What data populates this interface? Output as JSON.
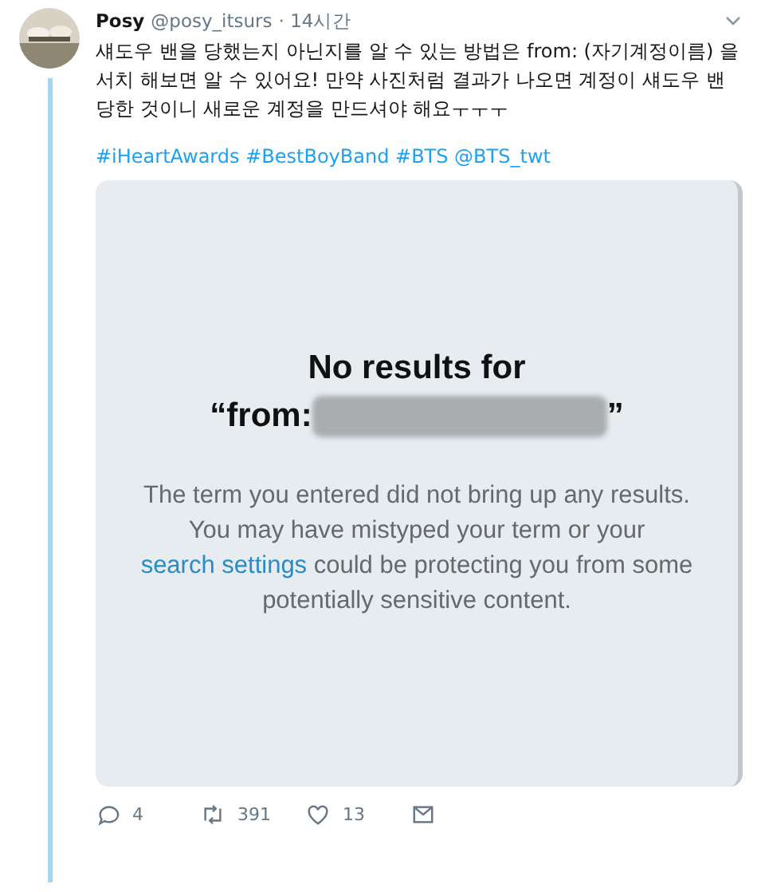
{
  "tweet": {
    "name": "Posy",
    "handle": "@posy_itsurs",
    "time": "· 14시간",
    "text": "섀도우 밴을 당했는지 아닌지를 알 수 있는 방법은 from: (자기계정이름) 을 서치 해보면 알 수 있어요! 만약 사진처럼 결과가 나오면 계정이 섀도우 밴 당한 것이니 새로운 계정을 만드셔야 해요ㅜㅜㅜ",
    "tags": "#iHeartAwards #BestBoyBand #BTS @BTS_twt",
    "screenshot": {
      "heading": "No results for",
      "query_prefix": "“from:",
      "query_suffix": "”",
      "body_before": "The term you entered did not bring up any results. You may have mistyped your term or your",
      "link": "search settings",
      "body_after": "could be protecting you from some potentially sensitive content."
    },
    "actions": [
      {
        "kind": "reply",
        "count": "4"
      },
      {
        "kind": "retweet",
        "count": "391"
      },
      {
        "kind": "like",
        "count": "13"
      },
      {
        "kind": "message"
      }
    ]
  }
}
